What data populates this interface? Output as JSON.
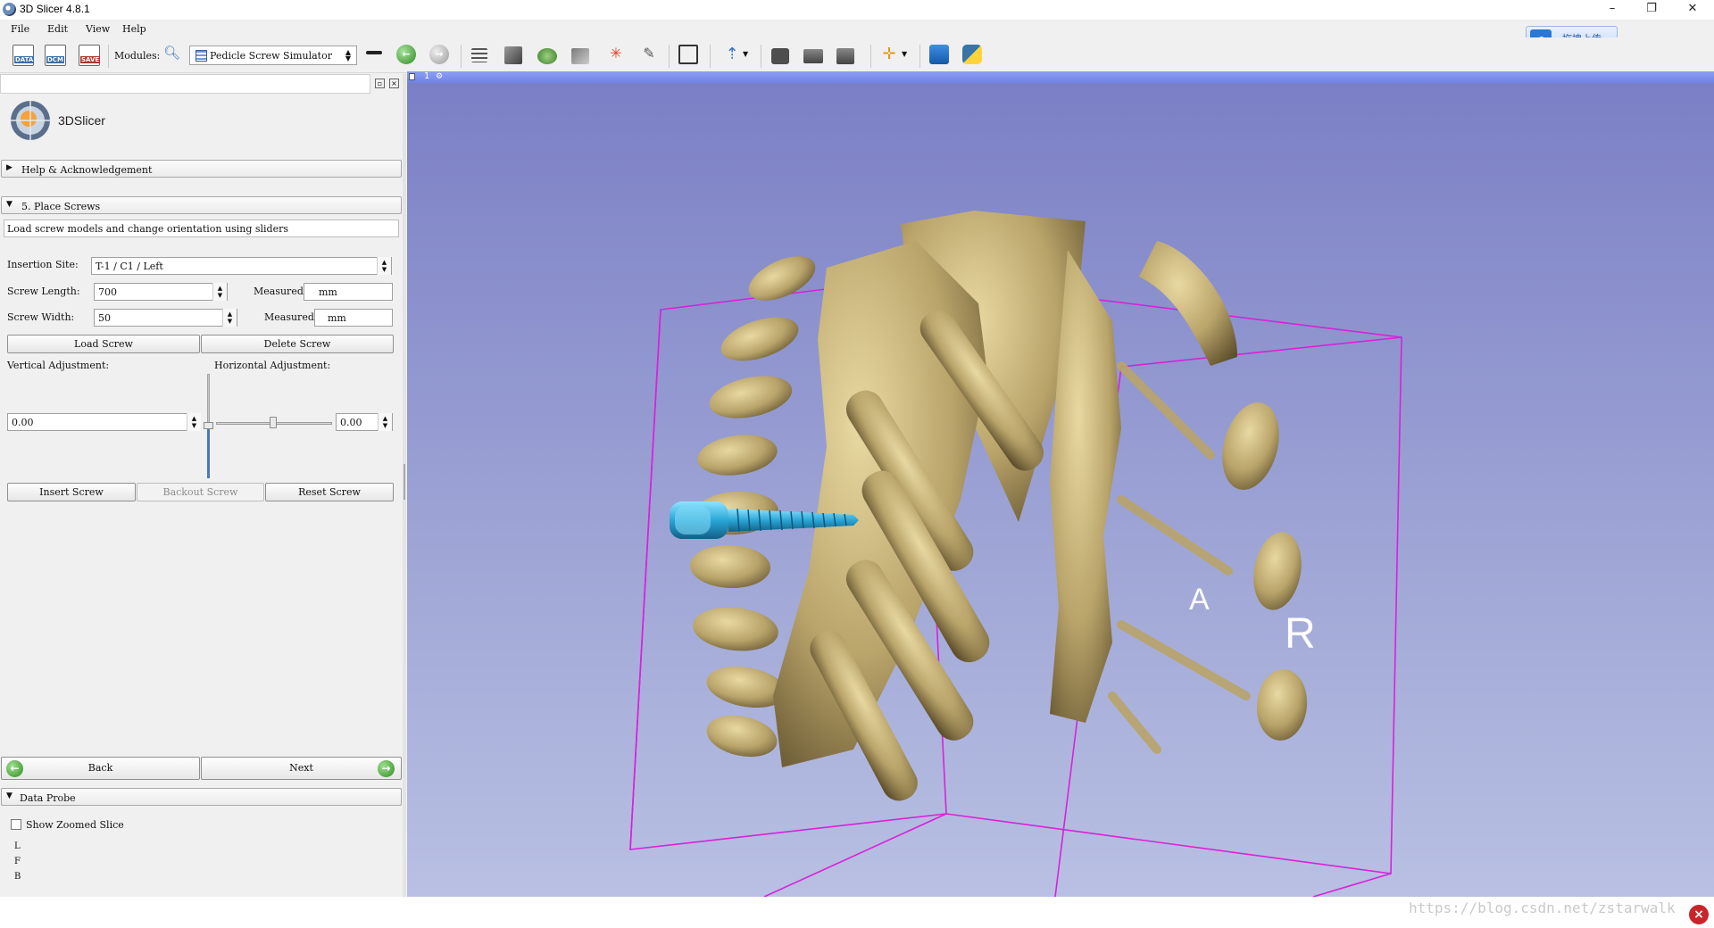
{
  "window": {
    "title": "3D Slicer 4.8.1",
    "minimize_glyph": "–",
    "restore_glyph": "❐",
    "close_glyph": "✕",
    "upload_badge": "拖拽上传"
  },
  "menu": {
    "file": "File",
    "edit": "Edit",
    "view": "View",
    "help": "Help"
  },
  "toolbar": {
    "data_label": "DATA",
    "dcm_label": "DCM",
    "save_label": "SAVE",
    "modules_label": "Modules:",
    "module_selected": "Pedicle Screw Simulator"
  },
  "panel": {
    "logo_text": "3DSlicer",
    "help_section": "Help & Acknowledgement",
    "place_section": "5. Place Screws",
    "description": "Load screw models and change orientation using sliders",
    "insertion_site_label": "Insertion Site:",
    "insertion_site_value": "T-1 / C1 / Left",
    "screw_length_label": "Screw Length:",
    "screw_length_value": "700",
    "measured_label_1": "Measured:",
    "measured_value_1": "mm",
    "screw_width_label": "Screw Width:",
    "screw_width_value": "50",
    "measured_label_2": "Measured:",
    "measured_value_2": "mm",
    "load_screw": "Load Screw",
    "delete_screw": "Delete Screw",
    "vertical_label": "Vertical Adjustment:",
    "horizontal_label": "Horizontal Adjustment:",
    "vertical_value": "0.00",
    "horizontal_value": "0.00",
    "vertical_level": 0.5,
    "horizontal_level": 0.5,
    "insert_screw": "Insert Screw",
    "backout_screw": "Backout Screw",
    "reset_screw": "Reset Screw",
    "back": "Back",
    "next": "Next",
    "data_probe_section": "Data Probe",
    "show_zoomed_slice": "Show Zoomed Slice",
    "probe_l": "L",
    "probe_f": "F",
    "probe_b": "B"
  },
  "viewer": {
    "view_number": "1",
    "orientation_a": "A",
    "orientation_r": "R",
    "background_top": "#7a7ec5",
    "background_bottom": "#b9c0e3",
    "bbox_color": "#d822d8",
    "bone_color": "#b9a46a",
    "screw_color": "#2aa6d6"
  },
  "footer": {
    "watermark": "https://blog.csdn.net/zstarwalk"
  }
}
